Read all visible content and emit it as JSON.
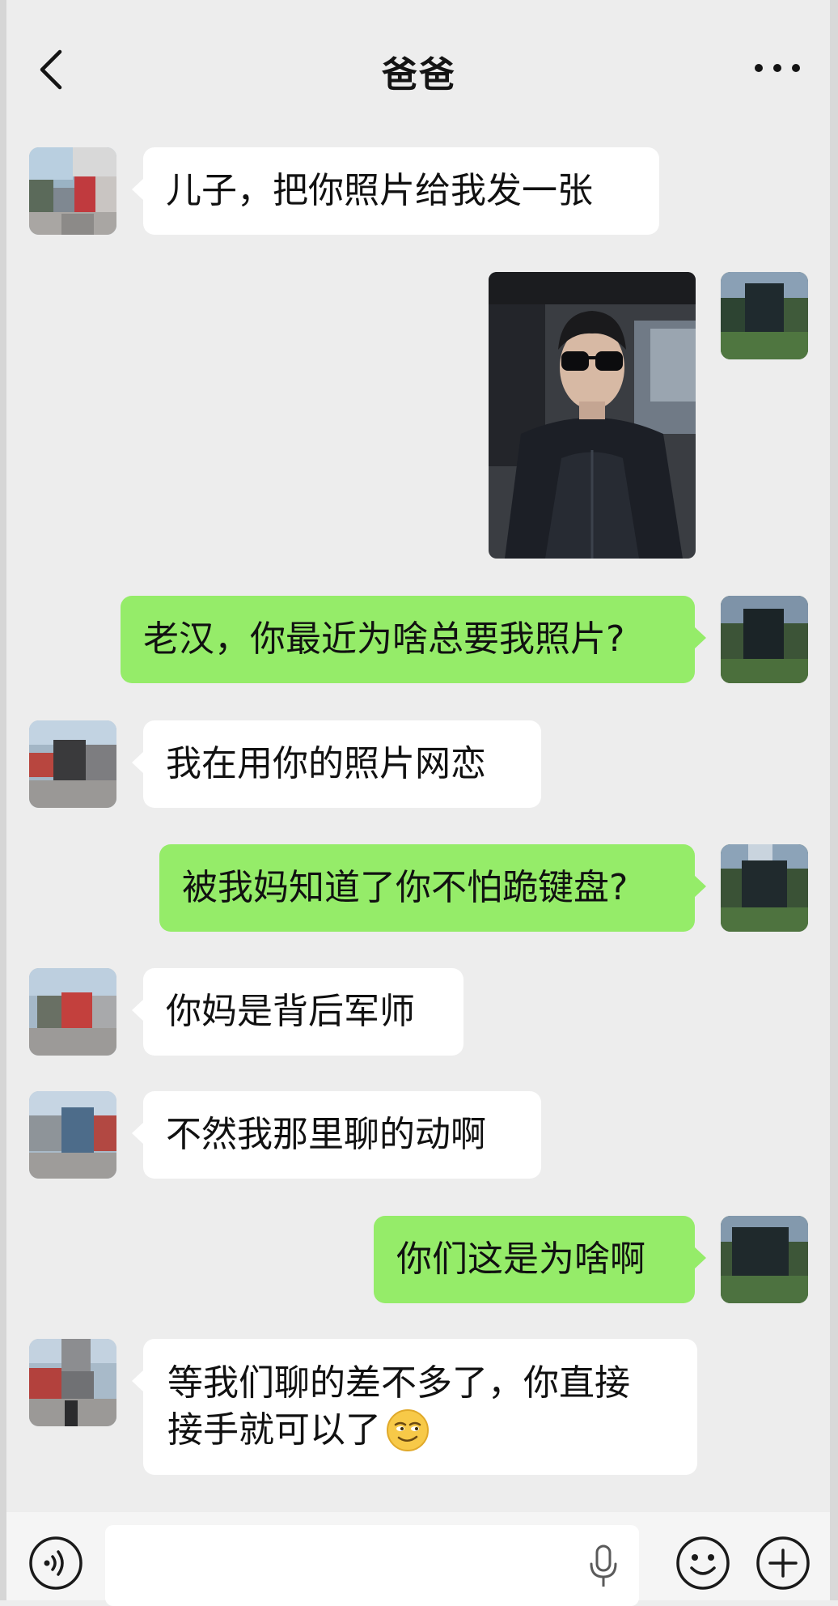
{
  "header": {
    "title": "爸爸",
    "back_icon": "chevron-left-icon",
    "more_icon": "more-dots-icon"
  },
  "messages": [
    {
      "side": "in",
      "type": "text",
      "text": "儿子，把你照片给我发一张"
    },
    {
      "side": "out",
      "type": "image",
      "image": "selfie-photo"
    },
    {
      "side": "out",
      "type": "text",
      "text": "老汉，你最近为啥总要我照片?"
    },
    {
      "side": "in",
      "type": "text",
      "text": "我在用你的照片网恋"
    },
    {
      "side": "out",
      "type": "text",
      "text": "被我妈知道了你不怕跪键盘?"
    },
    {
      "side": "in",
      "type": "text",
      "text": "你妈是背后军师"
    },
    {
      "side": "in",
      "type": "text",
      "text": "不然我那里聊的动啊"
    },
    {
      "side": "out",
      "type": "text",
      "text": "你们这是为啥啊"
    },
    {
      "side": "in",
      "type": "text",
      "line1": "等我们聊的差不多了，你直接",
      "line2": "接手就可以了",
      "emoji": "smirk-emoji"
    }
  ],
  "input_bar": {
    "icons": [
      "voice-icon",
      "microphone-icon",
      "emoji-icon",
      "plus-icon"
    ]
  },
  "colors": {
    "background": "#ededed",
    "incoming_bubble": "#ffffff",
    "outgoing_bubble": "#95ec69"
  }
}
